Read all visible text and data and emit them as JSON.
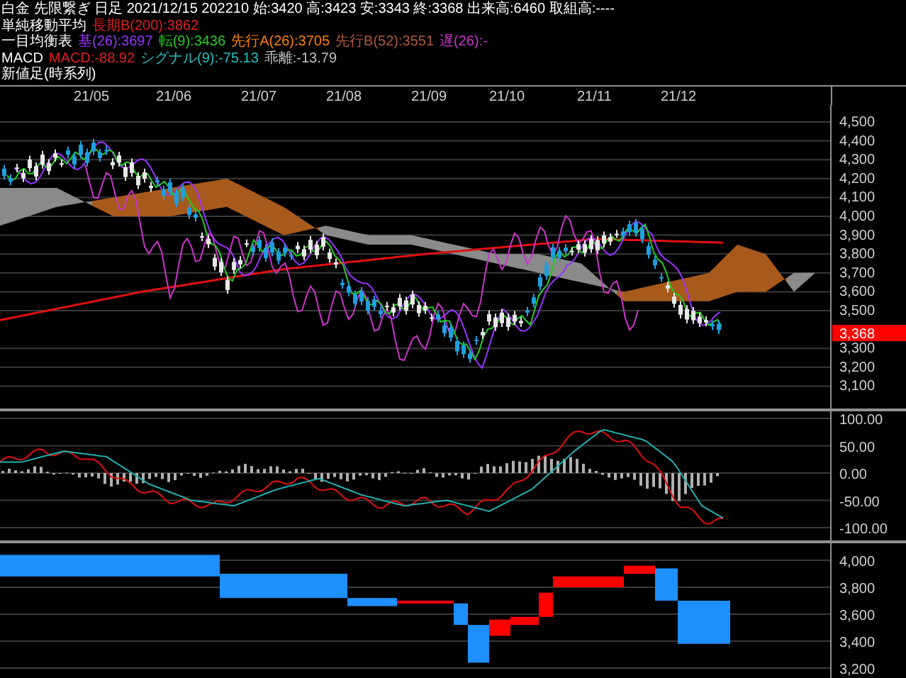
{
  "header": {
    "lines": [
      {
        "segments": [
          {
            "text": "白金 先限繋ぎ 日足 2021/12/15 202210 始:3420 高:3423 安:3343 終:3368 出来高:6460 取組高:----",
            "color": "#ffffff"
          }
        ]
      },
      {
        "segments": [
          {
            "text": "単純移動平均",
            "color": "#ffffff"
          },
          {
            "text": "長期B(200):3862",
            "color": "#e02020"
          }
        ]
      },
      {
        "segments": [
          {
            "text": "一目均衡表",
            "color": "#ffffff"
          },
          {
            "text": "基(26):3697",
            "color": "#9933ff"
          },
          {
            "text": "転(9):3436",
            "color": "#22cc22"
          },
          {
            "text": "先行A(26):3705",
            "color": "#ff8000"
          },
          {
            "text": "先行B(52):3551",
            "color": "#b05a3a"
          },
          {
            "text": "遅(26):-",
            "color": "#cc33cc"
          }
        ]
      },
      {
        "segments": [
          {
            "text": "MACD",
            "color": "#ffffff"
          },
          {
            "text": "MACD:-88.92",
            "color": "#e02020"
          },
          {
            "text": "シグナル(9):-75.13",
            "color": "#20c0c0"
          },
          {
            "text": "乖離:-13.79",
            "color": "#c0c0c0"
          }
        ]
      },
      {
        "segments": [
          {
            "text": "新値足(時系列)",
            "color": "#ffffff"
          }
        ]
      }
    ]
  },
  "x_axis": {
    "labels": [
      "21/05",
      "21/06",
      "21/07",
      "21/08",
      "21/09",
      "21/10",
      "21/11",
      "21/12"
    ]
  },
  "price_panel": {
    "ticks": [
      "4,500",
      "4,400",
      "4,300",
      "4,200",
      "4,100",
      "4,000",
      "3,900",
      "3,800",
      "3,700",
      "3,600",
      "3,500",
      "3,300",
      "3,200",
      "3,100"
    ],
    "last_price": "3,368"
  },
  "macd_panel": {
    "ticks": [
      "100.00",
      "50.00",
      "0.00",
      "-50.00",
      "-100.00"
    ]
  },
  "new_price_panel": {
    "ticks": [
      "4,000",
      "3,800",
      "3,600",
      "3,400",
      "3,200"
    ]
  }
}
